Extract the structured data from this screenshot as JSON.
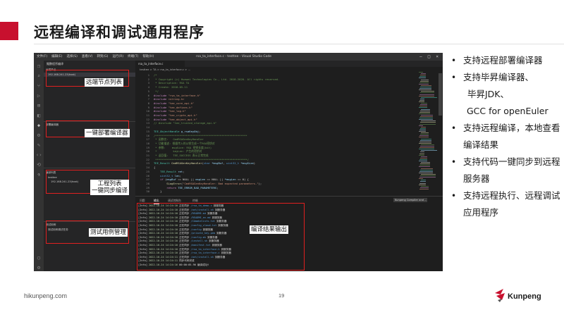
{
  "slide": {
    "title": "远程编译和调试通用程序",
    "footer_url": "hikunpeng.com",
    "page_number": "19",
    "logo_text": "Kunpeng",
    "accent_color": "#c8102e"
  },
  "vscode": {
    "window_title": "rsa_ta_interface.c - testtee - Visual Studio Code",
    "menu": [
      "文件(F)",
      "编辑(E)",
      "选择(S)",
      "查看(V)",
      "转到(G)",
      "运行(R)",
      "终端(T)",
      "帮助(H)"
    ],
    "sidebar_header": "鲲鹏程序编译",
    "sections": {
      "remote_nodes": {
        "title": "远端节点",
        "item": "192.168.241.23(host)"
      },
      "compilers": {
        "title": "部署编译器"
      },
      "projects": {
        "title": "编译列表",
        "item1": "testtee",
        "item2": "192.168.241.23(host)"
      },
      "tests": {
        "title": "测试用例",
        "item": "测试用例调试任务"
      }
    },
    "active_tab": "rsa_ta_interface.c",
    "breadcrumb": "testtee > TA > rsa_ta_interface.c > ...",
    "code_lines": [
      {
        "n": "1",
        "segs": [
          {
            "c": "cmt",
            "t": "/*"
          }
        ]
      },
      {
        "n": "2",
        "segs": [
          {
            "c": "cmt",
            "t": " * Copyright (c) Huawei Technologies Co., Ltd. 2018-2020. All rights reserved."
          }
        ]
      },
      {
        "n": "3",
        "segs": [
          {
            "c": "cmt",
            "t": " * Description: RSA TA"
          }
        ]
      },
      {
        "n": "4",
        "segs": [
          {
            "c": "cmt",
            "t": " * Create: 2018-05-11"
          }
        ]
      },
      {
        "n": "5",
        "segs": [
          {
            "c": "cmt",
            "t": " */"
          }
        ]
      },
      {
        "n": "6",
        "segs": [
          {
            "c": "kw",
            "t": "#include "
          },
          {
            "c": "str",
            "t": "\"rsa_ta_interface.h\""
          }
        ]
      },
      {
        "n": "7",
        "segs": [
          {
            "c": "kw",
            "t": "#include "
          },
          {
            "c": "str",
            "t": "<string.h>"
          }
        ]
      },
      {
        "n": "8",
        "segs": [
          {
            "c": "kw",
            "t": "#include "
          },
          {
            "c": "str",
            "t": "\"tee_core_api.h\""
          }
        ]
      },
      {
        "n": "9",
        "segs": [
          {
            "c": "kw",
            "t": "#include "
          },
          {
            "c": "str",
            "t": "\"tee_defines.h\""
          }
        ]
      },
      {
        "n": "10",
        "segs": [
          {
            "c": "kw",
            "t": "#include "
          },
          {
            "c": "str",
            "t": "\"tee_log.h\""
          }
        ]
      },
      {
        "n": "11",
        "segs": [
          {
            "c": "kw",
            "t": "#include "
          },
          {
            "c": "str",
            "t": "\"tee_crypto_api.h\""
          }
        ]
      },
      {
        "n": "12",
        "segs": [
          {
            "c": "kw",
            "t": "#include "
          },
          {
            "c": "str",
            "t": "\"tee_object_api.h\""
          }
        ]
      },
      {
        "n": "13",
        "segs": [
          {
            "c": "cmt",
            "t": "// #include \"tee_trusted_storage_api.h\""
          }
        ]
      },
      {
        "n": "14",
        "segs": [
          {
            "c": "pl",
            "t": ""
          }
        ]
      },
      {
        "n": "15",
        "segs": [
          {
            "c": "ty",
            "t": "TEE_ObjectHandle "
          },
          {
            "c": "id",
            "t": "g_rsaKeyObj"
          },
          {
            "c": "pl",
            "t": ";"
          }
        ]
      },
      {
        "n": "16",
        "segs": [
          {
            "c": "cmt",
            "t": "/*********************************************************"
          }
        ]
      },
      {
        "n": "17",
        "segs": [
          {
            "c": "cmt",
            "t": " * 函数名:   CmdRSAGenKeyHandler"
          }
        ]
      },
      {
        "n": "18",
        "segs": [
          {
            "c": "cmt",
            "t": " * 功能描述: 根据传入的公钥生成一个RSA密钥对"
          }
        ]
      },
      {
        "n": "19",
        "segs": [
          {
            "c": "cmt",
            "t": " * 参数:    msgSize: RSA 密钥长度(bit)"
          }
        ]
      },
      {
        "n": "20",
        "segs": [
          {
            "c": "cmt",
            "t": " *          keyLen: 产生的密钥对"
          }
        ]
      },
      {
        "n": "21",
        "segs": [
          {
            "c": "cmt",
            "t": " * 返回值:   TEE_SUCCESS 表示正常完成"
          }
        ]
      },
      {
        "n": "22",
        "segs": [
          {
            "c": "cmt",
            "t": " *********************************************************/"
          }
        ]
      },
      {
        "n": "23",
        "segs": [
          {
            "c": "ty",
            "t": "TEE_Result "
          },
          {
            "c": "fn",
            "t": "CmdRSAGenKeyHandler"
          },
          {
            "c": "pl",
            "t": "("
          },
          {
            "c": "bl",
            "t": "char "
          },
          {
            "c": "id",
            "t": "*msgBuf"
          },
          {
            "c": "pl",
            "t": ", "
          },
          {
            "c": "bl",
            "t": "uint32_t "
          },
          {
            "c": "id",
            "t": "*msgSize"
          },
          {
            "c": "pl",
            "t": ")"
          }
        ]
      },
      {
        "n": "24",
        "segs": [
          {
            "c": "pl",
            "t": "{"
          }
        ]
      },
      {
        "n": "25",
        "segs": [
          {
            "c": "pl",
            "t": "    "
          },
          {
            "c": "ty",
            "t": "TEE_Result "
          },
          {
            "c": "id",
            "t": "ret"
          },
          {
            "c": "pl",
            "t": ";"
          }
        ]
      },
      {
        "n": "26",
        "segs": [
          {
            "c": "pl",
            "t": "    "
          },
          {
            "c": "bl",
            "t": "uint32_t "
          },
          {
            "c": "id",
            "t": "len"
          },
          {
            "c": "pl",
            "t": ";"
          }
        ]
      },
      {
        "n": "27",
        "segs": [
          {
            "c": "pl",
            "t": "    "
          },
          {
            "c": "kw",
            "t": "if "
          },
          {
            "c": "pl",
            "t": "("
          },
          {
            "c": "id",
            "t": "msgBuf "
          },
          {
            "c": "pl",
            "t": "== NULL || "
          },
          {
            "c": "id",
            "t": "msgLen "
          },
          {
            "c": "pl",
            "t": "== NULL || "
          },
          {
            "c": "id",
            "t": "*msgLen "
          },
          {
            "c": "pl",
            "t": "== 0) {"
          }
        ]
      },
      {
        "n": "28",
        "segs": [
          {
            "c": "pl",
            "t": "        "
          },
          {
            "c": "fn",
            "t": "SLogError"
          },
          {
            "c": "pl",
            "t": "("
          },
          {
            "c": "str",
            "t": "\"CmdRSAGenKeyHandler: Bad expected parameters.\""
          },
          {
            "c": "pl",
            "t": ");"
          }
        ]
      },
      {
        "n": "29",
        "segs": [
          {
            "c": "pl",
            "t": "        "
          },
          {
            "c": "kw",
            "t": "return "
          },
          {
            "c": "id",
            "t": "TEE_ERROR_BAD_PARAMETERS"
          },
          {
            "c": "pl",
            "t": ";"
          }
        ]
      },
      {
        "n": "30",
        "segs": [
          {
            "c": "pl",
            "t": "    }"
          }
        ]
      }
    ],
    "panel_tabs": [
      "问题",
      "输出",
      "调试控制台",
      "终端"
    ],
    "panel_active": "输出",
    "panel_select": "Kunpeng Compiler and ...",
    "output_lines": [
      {
        "lvl": "[Info]",
        "ts": "2022-10-24 14:24:10",
        "msg": "正在同步",
        "path": "/rsa_ta_demo.c",
        "tail": "到服务器"
      },
      {
        "lvl": "[Info]",
        "ts": "2022-10-24 14:24:10",
        "msg": "正在同步",
        "path": "/ant/install.sh",
        "tail": "到服务器"
      },
      {
        "lvl": "[Info]",
        "ts": "2022-10-24 14:24:10",
        "msg": "正在同步",
        "path": "/README.md",
        "tail": "到服务器"
      },
      {
        "lvl": "[Info]",
        "ts": "2022-10-24 14:24:10",
        "msg": "正在同步",
        "path": "/README_en.md",
        "tail": "到服务器"
      },
      {
        "lvl": "[Info]",
        "ts": "2022-10-24 14:24:10",
        "msg": "正在同步",
        "path": "/CAmakelists.txt",
        "tail": "到服务器"
      },
      {
        "lvl": "[Info]",
        "ts": "2022-10-24 14:24:10",
        "msg": "正在同步",
        "path": "/config_cloud.txt",
        "tail": "到服务器"
      },
      {
        "lvl": "[Info]",
        "ts": "2022-10-24 14:24:10",
        "msg": "正在同步",
        "path": "/config",
        "tail": "到服务器"
      },
      {
        "lvl": "[Info]",
        "ts": "2022-10-24 14:24:10",
        "msg": "正在同步",
        "path": "/private_key.pem",
        "tail": "到服务器"
      },
      {
        "lvl": "[Info]",
        "ts": "2022-10-24 14:24:10",
        "msg": "正在同步",
        "path": "/config.mk",
        "tail": "到服务器"
      },
      {
        "lvl": "[Info]",
        "ts": "2022-10-24 14:24:10",
        "msg": "正在同步",
        "path": "/install.sh",
        "tail": "到服务器"
      },
      {
        "lvl": "[Info]",
        "ts": "2022-10-24 14:24:10",
        "msg": "正在同步",
        "path": "/manifest.txt",
        "tail": "到服务器"
      },
      {
        "lvl": "[Info]",
        "ts": "2022-10-24 14:24:10",
        "msg": "正在同步",
        "path": "/rsa_ta_interface.h",
        "tail": "到服务器"
      },
      {
        "lvl": "[Info]",
        "ts": "2022-10-24 14:24:10",
        "msg": "正在同步",
        "path": "/rsa_ta_interface.c",
        "tail": "到服务器"
      },
      {
        "lvl": "[Info]",
        "ts": "2022-10-24 14:24:11",
        "msg": "正在同步",
        "path": "/ant/install.sh",
        "tail": "到服务器"
      },
      {
        "lvl": "[Info]",
        "ts": "2022-10-24 14:24:11",
        "msg": "同步代码完成",
        "path": "",
        "tail": ""
      },
      {
        "lvl": "[Info]",
        "ts": "2022-10-24 14:24:16",
        "msg": "00:00:05.96 编译成功!",
        "path": "",
        "tail": ""
      }
    ]
  },
  "annotations": {
    "remote_nodes": "远端节点列表",
    "compilers": "一键部署编译器",
    "projects_line1": "工程列表",
    "projects_line2": "一键同步编译",
    "tests": "测试用例管理",
    "output": "编译结果输出"
  },
  "bullets": [
    {
      "text": "支持远程部署编译器"
    },
    {
      "text": "支持毕昇编译器、",
      "subs": [
        "毕昇JDK、",
        "GCC for openEuler"
      ]
    },
    {
      "text": "支持远程编译，本地查看编译结果"
    },
    {
      "text": "支持代码一键同步到远程服务器"
    },
    {
      "text": "支持远程执行、远程调试应用程序"
    }
  ]
}
